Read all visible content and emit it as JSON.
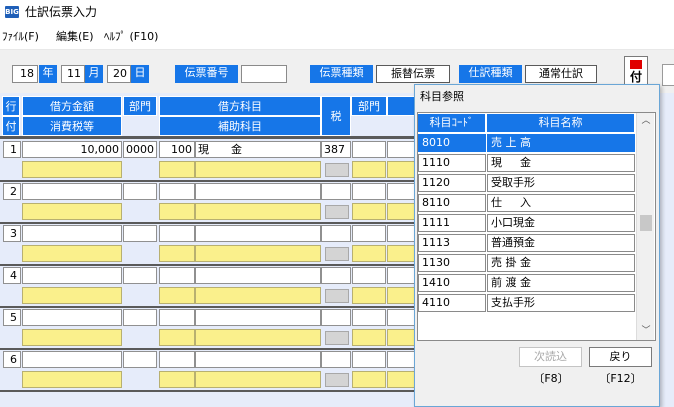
{
  "window": {
    "title": "仕訳伝票入力",
    "icon_text": "BIG"
  },
  "menu": {
    "file": "ﾌｧｲﾙ(F)",
    "edit": "編集(E)",
    "help": "ﾍﾙﾌﾟ (F10)"
  },
  "date": {
    "year": "18",
    "year_label": "年",
    "month": "11",
    "month_label": "月",
    "day": "20",
    "day_label": "日"
  },
  "voucher": {
    "number_label": "伝票番号",
    "number_value": "",
    "type_label": "伝票種類",
    "type_value": "振替伝票",
    "entry_type_label": "仕訳種類",
    "entry_type_value": "通常仕訳"
  },
  "flag_button": {
    "label": "付"
  },
  "grid": {
    "headers": {
      "row": "行",
      "attach": "付",
      "debit_amount": "借方金額",
      "consumption_tax": "消費税等",
      "department": "部門",
      "debit_account": "借方科目",
      "sub_account": "補助科目",
      "tax": "税",
      "department2": "部門"
    },
    "rows": [
      {
        "num": "1",
        "amount": "10,000",
        "dept": "0000",
        "code": "100",
        "account": "現　　金",
        "tax": "387"
      },
      {
        "num": "2",
        "amount": "",
        "dept": "",
        "code": "",
        "account": "",
        "tax": ""
      },
      {
        "num": "3",
        "amount": "",
        "dept": "",
        "code": "",
        "account": "",
        "tax": ""
      },
      {
        "num": "4",
        "amount": "",
        "dept": "",
        "code": "",
        "account": "",
        "tax": ""
      },
      {
        "num": "5",
        "amount": "",
        "dept": "",
        "code": "",
        "account": "",
        "tax": ""
      },
      {
        "num": "6",
        "amount": "",
        "dept": "",
        "code": "",
        "account": "",
        "tax": ""
      }
    ]
  },
  "dialog": {
    "title": "科目参照",
    "col_code": "科目ｺｰﾄﾞ",
    "col_name": "科目名称",
    "items": [
      {
        "code": "8010",
        "name": "売 上 高"
      },
      {
        "code": "1110",
        "name": "現 　 金"
      },
      {
        "code": "1120",
        "name": "受取手形"
      },
      {
        "code": "8110",
        "name": "仕 　 入"
      },
      {
        "code": "1111",
        "name": "小口現金"
      },
      {
        "code": "1113",
        "name": "普通預金"
      },
      {
        "code": "1130",
        "name": "売 掛 金"
      },
      {
        "code": "1410",
        "name": "前 渡 金"
      },
      {
        "code": "4110",
        "name": "支払手形"
      }
    ],
    "next_button": "次読込",
    "next_key": "〔F8〕",
    "back_button": "戻り",
    "back_key": "〔F12〕"
  },
  "colors": {
    "header_blue": "#1676e8",
    "input_yellow": "#faf08c",
    "grid_bg": "#e6ecfa",
    "flag_red": "#e00000"
  }
}
